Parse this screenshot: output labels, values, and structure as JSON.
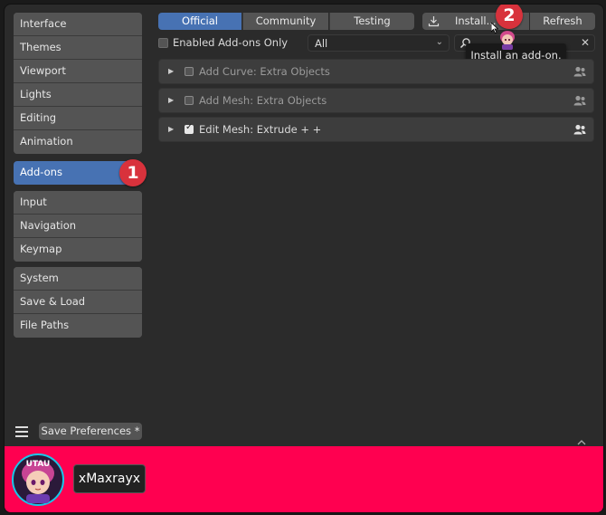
{
  "sidebar": {
    "group1": [
      "Interface",
      "Themes",
      "Viewport",
      "Lights",
      "Editing",
      "Animation"
    ],
    "active": "Add-ons",
    "group2": [
      "Input",
      "Navigation",
      "Keymap"
    ],
    "group3": [
      "System",
      "Save & Load",
      "File Paths"
    ]
  },
  "tabs": [
    "Official",
    "Community",
    "Testing"
  ],
  "toolbar": {
    "install_label": "Install...",
    "refresh_label": "Refresh"
  },
  "filter": {
    "enabled_only_label": "Enabled Add-ons Only",
    "category_value": "All"
  },
  "search": {
    "value": ""
  },
  "tooltip": "Install an add-on.",
  "addons": [
    {
      "label": "Add Curve: Extra Objects",
      "enabled": false
    },
    {
      "label": "Add Mesh: Extra Objects",
      "enabled": false
    },
    {
      "label": "Edit Mesh: Extrude + +",
      "enabled": true
    }
  ],
  "footer": {
    "save_label": "Save Preferences *"
  },
  "badges": {
    "one": "1",
    "two": "2"
  },
  "user": {
    "name": "xMaxrayx",
    "avatar_text": "UTAU"
  },
  "colors": {
    "accent": "#4772b3",
    "badge": "#d8323c",
    "banner": "#ff0050"
  }
}
